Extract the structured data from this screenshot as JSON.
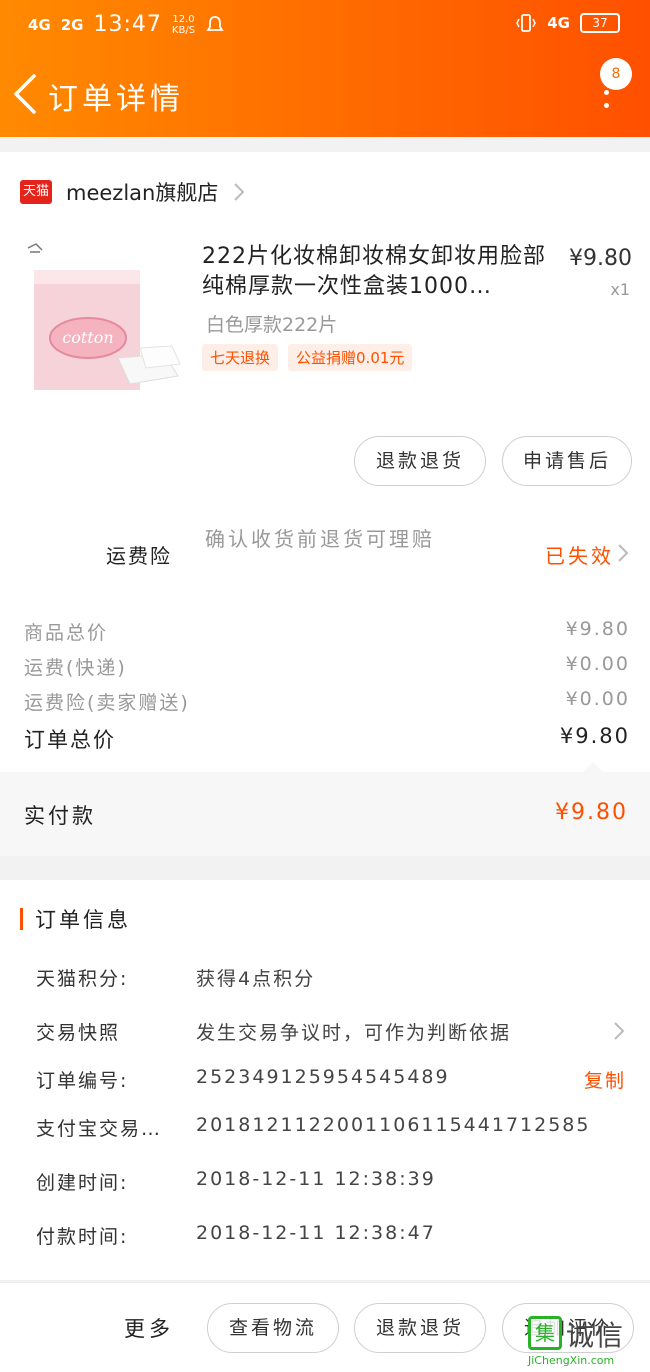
{
  "status_bar": {
    "signal1": "4G",
    "signal2": "2G",
    "time": "13:47",
    "speed": "12.0",
    "speed_unit": "KB/S",
    "network_right": "4G",
    "battery": "37"
  },
  "header": {
    "title": "订单详情",
    "message_badge": "8"
  },
  "shop": {
    "platform_logo": "天猫",
    "name": "meezlan旗舰店"
  },
  "product": {
    "title": "222片化妆棉卸妆棉女卸妆用脸部纯棉厚款一次性盒装1000…",
    "price": "¥9.80",
    "quantity": "x1",
    "sku": "白色厚款222片",
    "tags": [
      "七天退换",
      "公益捐赠0.01元"
    ],
    "image_text": "cotton"
  },
  "product_actions": {
    "refund": "退款退货",
    "after_sale": "申请售后"
  },
  "insurance": {
    "label": "运费险",
    "description": "确认收货前退货可理赔",
    "status": "已失效"
  },
  "summary": {
    "rows": [
      {
        "label": "商品总价",
        "value": "¥9.80"
      },
      {
        "label": "运费(快递)",
        "value": "¥0.00"
      },
      {
        "label": "运费险(卖家赠送)",
        "value": "¥0.00"
      }
    ],
    "total_label": "订单总价",
    "total_value": "¥9.80"
  },
  "payment": {
    "label": "实付款",
    "value": "¥9.80"
  },
  "order_info": {
    "title": "订单信息",
    "rows": [
      {
        "key": "天猫积分:",
        "value": "获得4点积分"
      },
      {
        "key": "交易快照",
        "value": "发生交易争议时，可作为判断依据"
      },
      {
        "key": "订单编号:",
        "value": "252349125954545489",
        "action": "复制"
      },
      {
        "key": "支付宝交易…",
        "value": "2018121122001106115441712585"
      },
      {
        "key": "创建时间:",
        "value": "2018-12-11 12:38:39"
      },
      {
        "key": "付款时间:",
        "value": "2018-12-11 12:38:47"
      }
    ]
  },
  "bottom_bar": {
    "more": "更多",
    "logistics": "查看物流",
    "refund": "退款退货",
    "review": "追加评价"
  },
  "watermark": {
    "icon_text": "集",
    "name": "诚信",
    "url": "JiChengXin.com"
  },
  "colors": {
    "brand_orange": "#ff5000",
    "header_gradient_start": "#ff8a00",
    "header_gradient_end": "#ff5000"
  }
}
